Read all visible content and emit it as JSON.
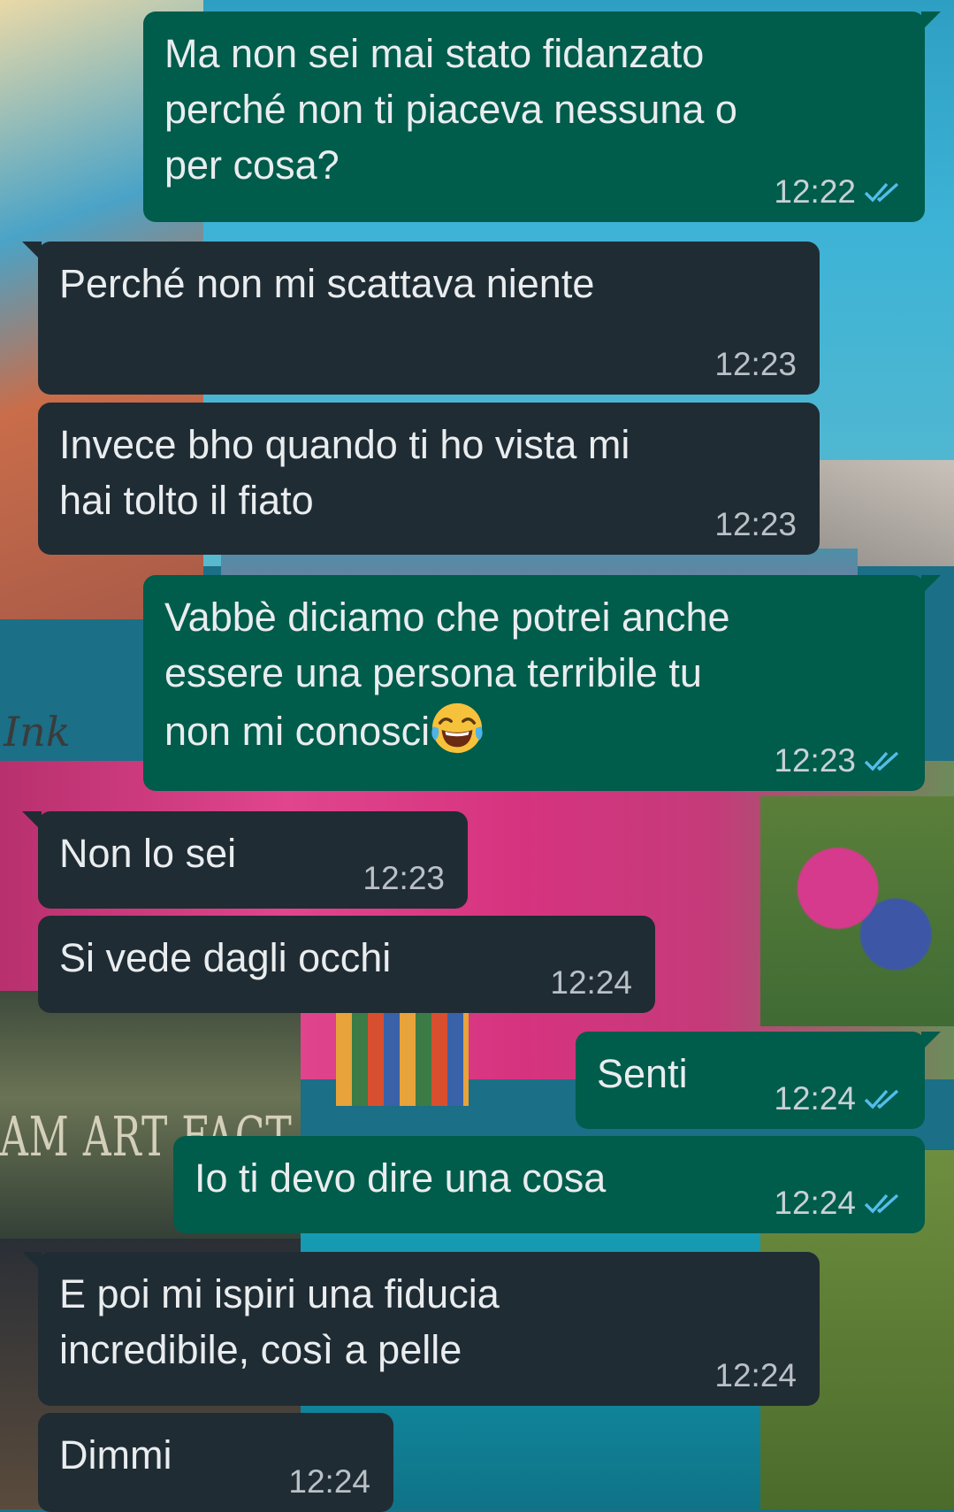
{
  "chat": {
    "messages": [
      {
        "direction": "out",
        "text": "Ma non sei mai stato fidanzato\nperché non ti piaceva nessuna o\nper cosa?",
        "time": "12:22",
        "status": "read"
      },
      {
        "direction": "in",
        "text": "Perché non mi scattava niente",
        "time": "12:23"
      },
      {
        "direction": "in",
        "text": "Invece bho quando ti ho vista mi\nhai tolto il fiato",
        "time": "12:23"
      },
      {
        "direction": "out",
        "text": "Vabbè diciamo che potrei anche\nessere una persona terribile tu\nnon mi conosci",
        "emoji": "face-with-tears-of-joy",
        "time": "12:23",
        "status": "read"
      },
      {
        "direction": "in",
        "text": "Non lo sei",
        "time": "12:23"
      },
      {
        "direction": "in",
        "text": "Si vede dagli occhi",
        "time": "12:24"
      },
      {
        "direction": "out",
        "text": "Senti",
        "time": "12:24",
        "status": "read"
      },
      {
        "direction": "out",
        "text": "Io ti devo dire una cosa",
        "time": "12:24",
        "status": "read"
      },
      {
        "direction": "in",
        "text": "E poi mi ispiri una fiducia\nincredibile, così a pelle",
        "time": "12:24"
      },
      {
        "direction": "in",
        "text": "Dimmi",
        "time": "12:24"
      }
    ]
  },
  "wallpaper": {
    "mural_text": "AM ART FACT",
    "mural_sign": "Ink"
  },
  "colors": {
    "outgoing_bubble": "#005c4b",
    "incoming_bubble": "#202c33",
    "read_ticks": "#53bdeb",
    "text": "#e9edef"
  },
  "icons": {
    "read_receipt": "double-check-icon",
    "emoji": "face-with-tears-of-joy-icon"
  }
}
